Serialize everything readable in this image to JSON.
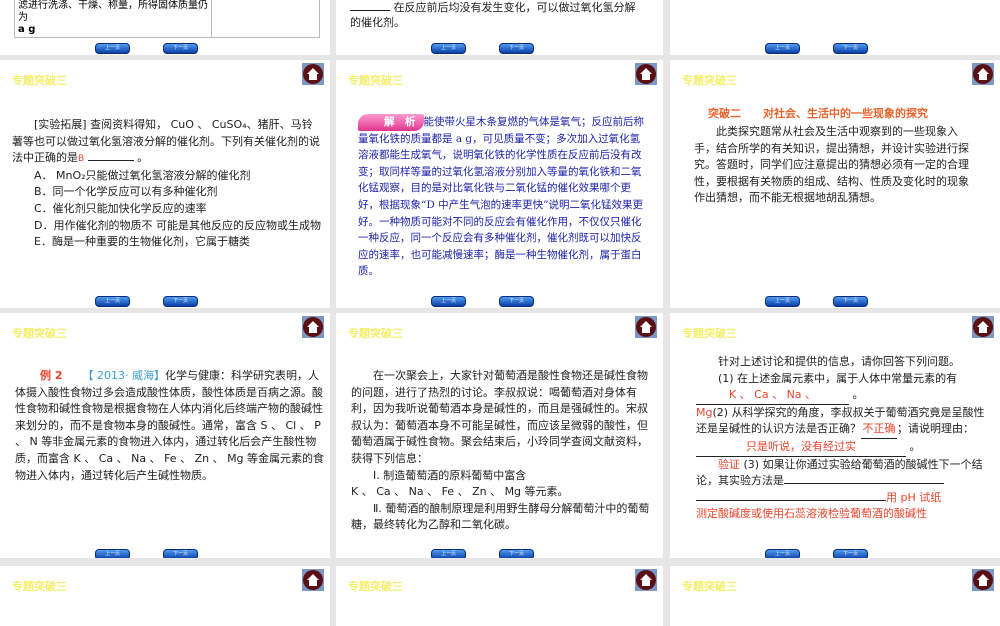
{
  "slide_header": "专题突破三",
  "nav": {
    "prev_label": "上一页",
    "next_label": "下一页"
  },
  "top_row": {
    "s1_table_line1": "滤进行洗涤、干燥、称量，所得固体质量仍为",
    "s1_table_line2": "a g",
    "s2_line1": "在反应前后均没有发生变化，可以做过氧化氢分解",
    "s2_line2": "的催化剂。"
  },
  "s4": {
    "intro": "[实验拓展] 查阅资料得知， CuO 、 CuSO₄、猪肝、马铃薯等也可以做过氧化氢溶液分解的催化剂。下列有关催化剂的说法中正确的是",
    "answer": "B",
    "options": [
      "A． MnO₂只能做过氧化氢溶液分解的催化剂",
      "B．同一个化学反应可以有多种催化剂",
      "C．催化剂只能加快化学反应的速率",
      "D．用作催化剂的物质不 可能是其他反应的反应物或生成物",
      "E．酶是一种重要的生物催化剂，它属于糖类"
    ]
  },
  "s5": {
    "tag": "解　析",
    "text": "能使带火星木条复燃的气体是氧气；反应前后称量氧化铁的质量都是 a g，可见质量不变；多次加入过氧化氢溶液都能生成氧气，说明氧化铁的化学性质在反应前后没有改变；取同样等量的过氧化氢溶液分别加入等量的氧化铁和二氧化锰观察，目的是对比氧化铁与二氧化锰的催化效果哪个更好，根据现象“D 中产生气泡的速率更快”说明二氧化锰效果更好。一种物质可能对不同的反应会有催化作用，不仅仅只催化一种反应，同一个反应会有多种催化剂，催化剂既可以加快反应的速率，也可能减慢速率；酶是一种生物催化剂，属于蛋白质。"
  },
  "s6": {
    "title_a": "突破二",
    "title_b": "对社会、生活中的一些现象的探究",
    "text": "此类探究题常从社会及生活中观察到的一些现象入手，结合所学的有关知识，提出猜想，并设计实验进行探究。答题时，同学们应注意提出的猜想必须有一定的合理性，要根据有关物质的组成、结构、性质及变化时的现象作出猜想，而不能无根据地胡乱猜想。"
  },
  "s7": {
    "label": "例 2",
    "source": "【 2013· 威海】",
    "text": "化学与健康：科学研究表明，人体摄入酸性食物过多会造成酸性体质，酸性体质是百病之源。酸性食物和碱性食物是根据食物在人体内消化后终端产物的酸碱性来划分的，而不是食物本身的酸碱性。通常，富含 S 、 Cl 、 P 、 N 等非金属元素的食物进入体内，通过转化后会产生酸性物质，而富含 K 、 Ca 、 Na 、 Fe 、 Zn 、 Mg 等金属元素的食物进入体内，通过转化后产生碱性物质。"
  },
  "s8": {
    "text": "在一次聚会上，大家针对葡萄酒是酸性食物还是碱性食物的问题，进行了热烈的讨论。李叔叔说：喝葡萄酒对身体有利，因为我听说葡萄酒本身是碱性的，而且是强碱性的。宋叔叔认为：葡萄酒本身不可能呈碱性，而应该呈微弱的酸性，但葡萄酒属于碱性食物。聚会结束后，小玲同学查阅文献资料，获得下列信息：",
    "info1a": "Ⅰ. 制造葡萄酒的原料葡萄中富含",
    "info1b": "K 、 Ca 、 Na 、 Fe 、 Zn 、 Mg 等元素。",
    "info2": "Ⅱ. 葡萄酒的酿制原理是利用野生酵母分解葡萄汁中的葡萄糖，最终转化为乙醇和二氧化碳。"
  },
  "s9": {
    "intro": "针对上述讨论和提供的信息，请你回答下列问题。",
    "q1": "(1) 在上述金属元素中，属于人体中常量元素的有",
    "a1": "K 、 Ca 、 Na 、",
    "a1b": "Mg",
    "q2": "(2) 从科学探究的角度，李叔叔关于葡萄酒究竟是呈酸性还是呈碱性的认识方法是否正确？",
    "a2": "不正确",
    "q2b": "；请说明理由：",
    "a2b": "只是听说，没有经过实",
    "a2c": "验证",
    "q3": "(3) 如果让你通过实验给葡萄酒的酸碱性下一个结论，其实验方法是",
    "a3a": "用 pH 试纸",
    "a3b": "测定酸碱度或使用石蕊溶液检验葡萄酒的酸碱性"
  }
}
